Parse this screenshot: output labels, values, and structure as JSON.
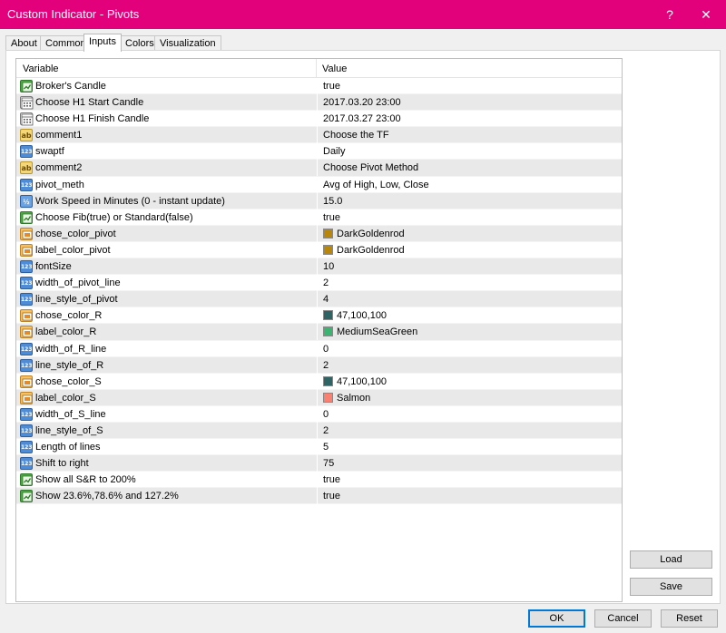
{
  "window": {
    "title": "Custom Indicator - Pivots",
    "help_label": "?",
    "close_label": "✕"
  },
  "tabs": [
    {
      "label": "About",
      "active": false
    },
    {
      "label": "Common",
      "active": false
    },
    {
      "label": "Inputs",
      "active": true
    },
    {
      "label": "Colors",
      "active": false
    },
    {
      "label": "Visualization",
      "active": false
    }
  ],
  "grid": {
    "header": {
      "variable": "Variable",
      "value": "Value"
    },
    "rows": [
      {
        "icon": "bool-icon",
        "variable": "Broker's Candle",
        "value": "true"
      },
      {
        "icon": "date-icon",
        "variable": "Choose H1 Start Candle",
        "value": "2017.03.20 23:00"
      },
      {
        "icon": "date-icon",
        "variable": "Choose H1 Finish Candle",
        "value": "2017.03.27 23:00"
      },
      {
        "icon": "string-icon",
        "variable": "comment1",
        "value": "Choose the TF"
      },
      {
        "icon": "int-icon",
        "variable": "swaptf",
        "value": "Daily"
      },
      {
        "icon": "string-icon",
        "variable": "comment2",
        "value": "Choose Pivot Method"
      },
      {
        "icon": "int-icon",
        "variable": "pivot_meth",
        "value": "Avg of High, Low, Close"
      },
      {
        "icon": "double-icon",
        "variable": "Work Speed in Minutes (0 - instant update)",
        "value": "15.0"
      },
      {
        "icon": "bool-icon",
        "variable": "Choose Fib(true) or Standard(false)",
        "value": "true"
      },
      {
        "icon": "color-icon",
        "variable": "chose_color_pivot",
        "value": "DarkGoldenrod",
        "swatch": "#b8860b"
      },
      {
        "icon": "color-icon",
        "variable": "label_color_pivot",
        "value": "DarkGoldenrod",
        "swatch": "#b8860b"
      },
      {
        "icon": "int-icon",
        "variable": "fontSize",
        "value": "10"
      },
      {
        "icon": "int-icon",
        "variable": "width_of_pivot_line",
        "value": "2"
      },
      {
        "icon": "int-icon",
        "variable": "line_style_of_pivot",
        "value": "4"
      },
      {
        "icon": "color-icon",
        "variable": "chose_color_R",
        "value": "47,100,100",
        "swatch": "#2f6464"
      },
      {
        "icon": "color-icon",
        "variable": "label_color_R",
        "value": "MediumSeaGreen",
        "swatch": "#3cb371"
      },
      {
        "icon": "int-icon",
        "variable": "width_of_R_line",
        "value": "0"
      },
      {
        "icon": "int-icon",
        "variable": "line_style_of_R",
        "value": "2"
      },
      {
        "icon": "color-icon",
        "variable": "chose_color_S",
        "value": "47,100,100",
        "swatch": "#2f6464"
      },
      {
        "icon": "color-icon",
        "variable": "label_color_S",
        "value": "Salmon",
        "swatch": "#fa8072"
      },
      {
        "icon": "int-icon",
        "variable": "width_of_S_line",
        "value": "0"
      },
      {
        "icon": "int-icon",
        "variable": "line_style_of_S",
        "value": "2"
      },
      {
        "icon": "int-icon",
        "variable": "Length of lines",
        "value": "5"
      },
      {
        "icon": "int-icon",
        "variable": "Shift to right",
        "value": "75"
      },
      {
        "icon": "bool-icon",
        "variable": "Show all S&R to 200%",
        "value": "true"
      },
      {
        "icon": "bool-icon",
        "variable": "Show 23.6%,78.6% and 127.2%",
        "value": "true"
      }
    ]
  },
  "icon_glyphs": {
    "string-icon": "ab",
    "int-icon": "123",
    "double-icon": "½"
  },
  "buttons": {
    "load": "Load",
    "save": "Save",
    "ok": "OK",
    "cancel": "Cancel",
    "reset": "Reset"
  }
}
